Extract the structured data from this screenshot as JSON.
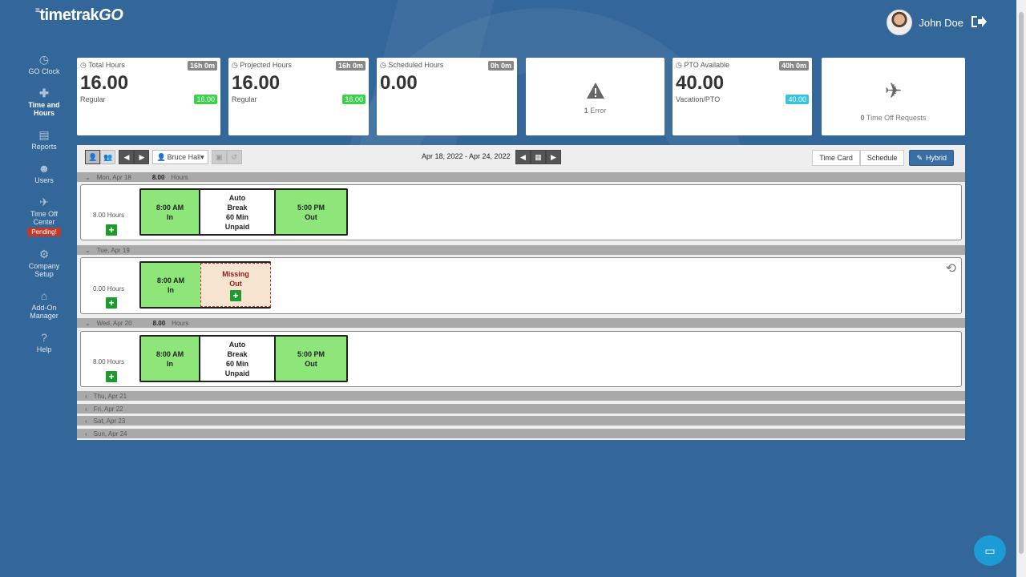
{
  "brand": {
    "name": "timetrak",
    "suffix": "GO"
  },
  "user": {
    "name": "John Doe"
  },
  "sidebar": {
    "items": [
      {
        "label": "GO Clock",
        "icon": "clock-icon"
      },
      {
        "label": "Time and Hours",
        "icon": "puzzle-icon"
      },
      {
        "label": "Reports",
        "icon": "document-icon"
      },
      {
        "label": "Users",
        "icon": "users-icon"
      },
      {
        "label": "Time Off Center",
        "icon": "plane-icon",
        "badge": "Pending!"
      },
      {
        "label": "Company Setup",
        "icon": "gear-icon"
      },
      {
        "label": "Add-On Manager",
        "icon": "store-icon"
      },
      {
        "label": "Help",
        "icon": "question-icon"
      }
    ]
  },
  "cards": {
    "total": {
      "label": "Total Hours",
      "tag": "16h 0m",
      "value": "16.00",
      "sub": "Regular",
      "pill": "16.00"
    },
    "projected": {
      "label": "Projected Hours",
      "tag": "16h 0m",
      "value": "16.00",
      "sub": "Regular",
      "pill": "16.00"
    },
    "scheduled": {
      "label": "Scheduled Hours",
      "tag": "0h 0m",
      "value": "0.00"
    },
    "errors": {
      "count": "1",
      "label": "Error"
    },
    "pto": {
      "label": "PTO Available",
      "tag": "40h 0m",
      "value": "40.00",
      "sub": "Vacation/PTO",
      "pill": "40.00"
    },
    "timeoff": {
      "count": "0",
      "label": "Time Off Requests"
    }
  },
  "toolbar": {
    "employee": "Bruce Hall",
    "date_range": "Apr 18, 2022 - Apr 24, 2022",
    "views": {
      "time_card": "Time Card",
      "schedule": "Schedule",
      "hybrid": "Hybrid"
    }
  },
  "days": [
    {
      "label": "Mon, Apr 18",
      "total": "8.00",
      "unit": "Hours",
      "hours": "8.00 Hours",
      "punches": {
        "in_time": "8:00 AM",
        "in_label": "In",
        "break": [
          "Auto",
          "Break",
          "60 Min",
          "Unpaid"
        ],
        "out_time": "5:00 PM",
        "out_label": "Out"
      }
    },
    {
      "label": "Tue, Apr 19",
      "hours": "0.00 Hours",
      "punches": {
        "in_time": "8:00 AM",
        "in_label": "In",
        "missing": [
          "Missing",
          "Out"
        ]
      }
    },
    {
      "label": "Wed, Apr 20",
      "total": "8.00",
      "unit": "Hours",
      "hours": "8.00 Hours",
      "punches": {
        "in_time": "8:00 AM",
        "in_label": "In",
        "break": [
          "Auto",
          "Break",
          "60 Min",
          "Unpaid"
        ],
        "out_time": "5:00 PM",
        "out_label": "Out"
      }
    },
    {
      "label": "Thu, Apr 21"
    },
    {
      "label": "Fri, Apr 22"
    },
    {
      "label": "Sat, Apr 23"
    },
    {
      "label": "Sun, Apr 24"
    }
  ],
  "colors": {
    "background": "#33679a",
    "green": "#8ee67a",
    "accent": "#3a6ea5",
    "pending": "#c0392b"
  }
}
